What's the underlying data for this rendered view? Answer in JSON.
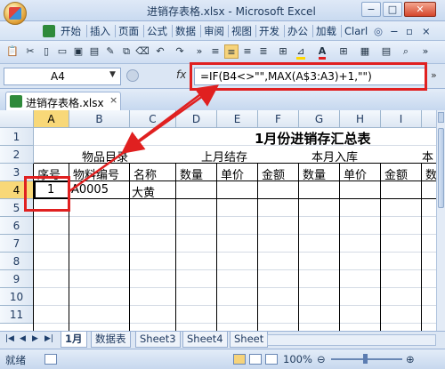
{
  "window": {
    "title": "进销存表格.xlsx - Microsoft Excel"
  },
  "menu": [
    "开始",
    "插入",
    "页面",
    "公式",
    "数据",
    "审阅",
    "视图",
    "开发",
    "办公",
    "加载",
    "Clarl"
  ],
  "formula_bar": {
    "name_box": "A4",
    "fx_label": "fx",
    "formula": "=IF(B4<>\"\",MAX(A$3:A3)+1,\"\")"
  },
  "workbook_tab": {
    "name": "进销存表格.xlsx"
  },
  "columns": [
    "A",
    "B",
    "C",
    "D",
    "E",
    "F",
    "G",
    "H",
    "I",
    "J"
  ],
  "rows": [
    "1",
    "2",
    "3",
    "4",
    "5",
    "6",
    "7",
    "8",
    "9",
    "10",
    "11"
  ],
  "sheet": {
    "title": "1月份进销存汇总表",
    "group_headers": {
      "product": "物品目录",
      "last_month": "上月结存",
      "this_month_in": "本月入库",
      "partial": "本"
    },
    "sub_headers": [
      "序号",
      "物料编号",
      "名称",
      "数量",
      "单价",
      "金额",
      "数量",
      "单价",
      "金额",
      "数量"
    ],
    "row4": {
      "seq": "1",
      "code": "A0005",
      "name": "大黄"
    }
  },
  "sheet_tabs": [
    "1月",
    "数据表",
    "Sheet3",
    "Sheet4",
    "Sheet"
  ],
  "status": {
    "ready": "就绪",
    "zoom": "100%"
  },
  "colors": {
    "annotation": "#e02020",
    "selected_header": "#f8d878"
  }
}
